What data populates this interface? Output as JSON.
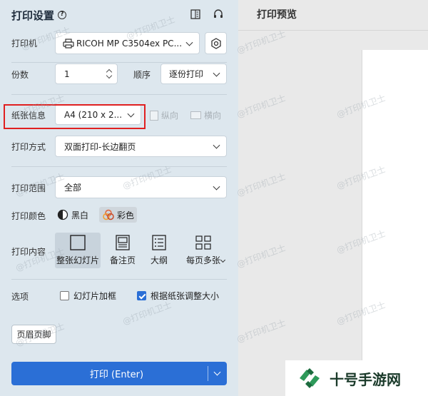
{
  "settings": {
    "title": "打印设置",
    "help_icon": "?"
  },
  "printer": {
    "label": "打印机",
    "value": "RICOH MP C3504ex PC..."
  },
  "copies": {
    "label": "份数",
    "value": "1",
    "order_label": "顺序",
    "order_value": "逐份打印"
  },
  "paper": {
    "label": "纸张信息",
    "value": "A4 (210 x 2...",
    "portrait": "纵向",
    "landscape": "横向"
  },
  "mode": {
    "label": "打印方式",
    "value": "双面打印-长边翻页"
  },
  "range": {
    "label": "打印范围",
    "value": "全部"
  },
  "color": {
    "label": "打印颜色",
    "bw": "黑白",
    "color": "彩色"
  },
  "content": {
    "label": "打印内容",
    "options": [
      "整张幻灯片",
      "备注页",
      "大纲",
      "每页多张"
    ]
  },
  "options": {
    "label": "选项",
    "frame": "幻灯片加框",
    "fit": "根据纸张调整大小"
  },
  "header_footer": "页眉页脚",
  "print_button": "打印 (Enter)",
  "preview": {
    "title": "打印预览"
  },
  "watermark": "@打印机卫士",
  "brand": "十号手游网",
  "colors": {
    "accent": "#2b6fd6",
    "panel": "#dde7ee",
    "highlight": "#e02020"
  }
}
